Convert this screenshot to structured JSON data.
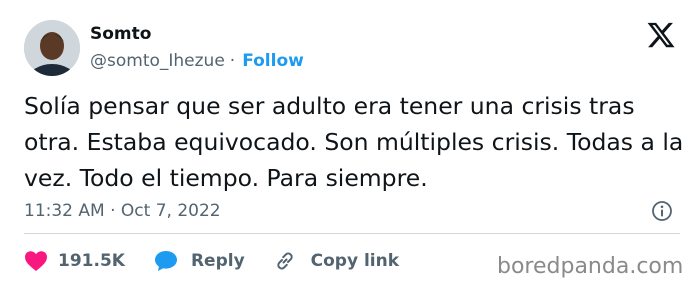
{
  "author": {
    "display_name": "Somto",
    "handle": "@somto_Ihezue",
    "separator": "·",
    "follow_label": "Follow"
  },
  "tweet": {
    "text": "Solía pensar que ser adulto era tener una crisis tras otra. Estaba equivocado. Son múltiples crisis. Todas a la vez. Todo el tiempo. Para siempre.",
    "timestamp": "11:32 AM · Oct 7, 2022"
  },
  "actions": {
    "likes_count": "191.5K",
    "reply_label": "Reply",
    "copy_link_label": "Copy link"
  },
  "icons": {
    "platform": "x-logo-icon",
    "info": "info-icon",
    "like": "heart-icon",
    "reply": "speech-bubble-icon",
    "copy": "link-icon"
  },
  "colors": {
    "accent": "#1d9bf0",
    "like": "#f91880",
    "muted": "#536471",
    "text": "#0f1419"
  },
  "watermark": "boredpanda.com"
}
